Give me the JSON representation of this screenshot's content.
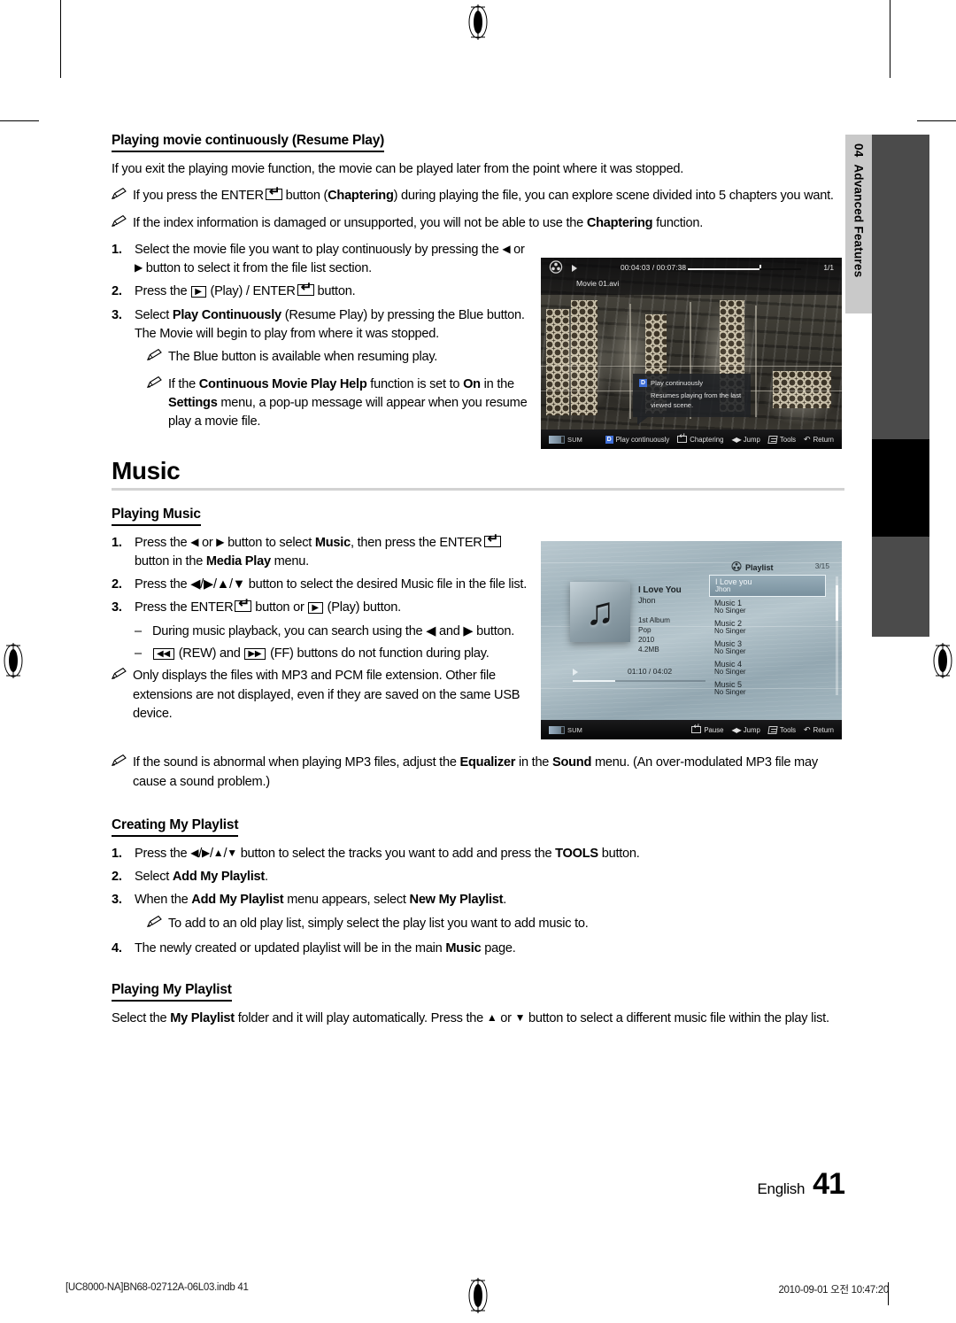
{
  "document": {
    "page_number": "41",
    "language_label": "English",
    "chapter_tab": {
      "number": "04",
      "title": "Advanced Features"
    },
    "footer": {
      "left": "[UC8000-NA]BN68-02712A-06L03.indb   41",
      "right": "2010-09-01   오전 10:47:20"
    }
  },
  "section_resume": {
    "heading": "Playing movie continuously (Resume Play)",
    "intro": "If you exit the playing movie function, the movie can be played later from the point where it was stopped.",
    "notes": [
      {
        "pre": "If you press the ",
        "key": "ENTER",
        "post_a": " button (",
        "bold_a": "Chaptering",
        "post_b": ") during playing the file, you can explore scene divided into 5 chapters you want."
      },
      {
        "pre": "If the index information is damaged or unsupported, you will not be able to use the ",
        "bold_a": "Chaptering",
        "post_b": " function."
      }
    ],
    "steps": [
      {
        "num": "1.",
        "text": "Select the movie file you want to play continuously by pressing the ◀ or ▶ button to select it from the file list section."
      },
      {
        "num": "2.",
        "text": "Press the ▶ (Play) / ENTER button."
      },
      {
        "num": "3.",
        "text": "Select Play Continuously (Resume Play) by pressing the Blue button. The Movie will begin to play from where it was stopped."
      }
    ],
    "step3_notes": [
      "The Blue button is available when resuming play.",
      "If the Continuous Movie Play Help function is set to On in the Settings menu, a pop-up message will appear when you resume play a movie file."
    ]
  },
  "section_music": {
    "title": "Music",
    "playing_music": {
      "heading": "Playing Music",
      "steps": [
        {
          "num": "1."
        },
        {
          "num": "2.",
          "text": "Press the ◀/▶/▲/▼ button to select the desired Music file in the file list."
        },
        {
          "num": "3."
        }
      ],
      "dash_notes": [
        "During music playback, you can search using the ◀ and ▶ button.",
        "(REW) and (FF) buttons do not function during play."
      ],
      "note": "Only displays the files with MP3 and PCM file extension. Other file extensions are not displayed, even if they are saved on the same USB device."
    },
    "equalizer_note": {
      "a": "If the sound is abnormal when playing MP3 files, adjust the ",
      "b": "Equalizer",
      "c": " in the ",
      "d": "Sound",
      "e": " menu. (An over-modulated MP3 file may cause a sound problem.)"
    },
    "creating_playlist": {
      "heading": "Creating My Playlist",
      "steps": [
        {
          "num": "1."
        },
        {
          "num": "2."
        },
        {
          "num": "3."
        },
        {
          "num": "4."
        }
      ],
      "note": "To add to an old play list, simply select the play list you want to add music to."
    },
    "playing_playlist": {
      "heading": "Playing My Playlist"
    }
  },
  "movie_screenshot": {
    "time_elapsed_total": "00:04:03 / 00:07:38",
    "page_indicator": "1/1",
    "file_name": "Movie 01.avi",
    "popup": {
      "key": "D",
      "title": "Play continuously",
      "body": "Resumes playing from the last viewed scene."
    },
    "source_label": "SUM",
    "actions": [
      {
        "key": "D",
        "label": "Play continuously"
      },
      {
        "key": "enter",
        "label": "Chaptering"
      },
      {
        "key": "jump",
        "label": "Jump"
      },
      {
        "key": "tools",
        "label": "Tools"
      },
      {
        "key": "return",
        "label": "Return"
      }
    ]
  },
  "music_screenshot": {
    "now_playing": {
      "title": "I Love You",
      "artist": "Jhon",
      "album": "1st Album",
      "genre": "Pop",
      "year": "2010",
      "size": "4.2MB",
      "time": "01:10 / 04:02"
    },
    "playlist_header": "Playlist",
    "playlist_count": "3/15",
    "playlist": [
      {
        "name": "I Love you",
        "sub": "Jhon",
        "selected": true
      },
      {
        "name": "Music 1",
        "sub": "No Singer",
        "selected": false
      },
      {
        "name": "Music 2",
        "sub": "No Singer",
        "selected": false
      },
      {
        "name": "Music 3",
        "sub": "No Singer",
        "selected": false
      },
      {
        "name": "Music 4",
        "sub": "No Singer",
        "selected": false
      },
      {
        "name": "Music 5",
        "sub": "No Singer",
        "selected": false
      }
    ],
    "source_label": "SUM",
    "actions": [
      {
        "key": "enter",
        "label": "Pause"
      },
      {
        "key": "jump",
        "label": "Jump"
      },
      {
        "key": "tools",
        "label": "Tools"
      },
      {
        "key": "return",
        "label": "Return"
      }
    ]
  }
}
